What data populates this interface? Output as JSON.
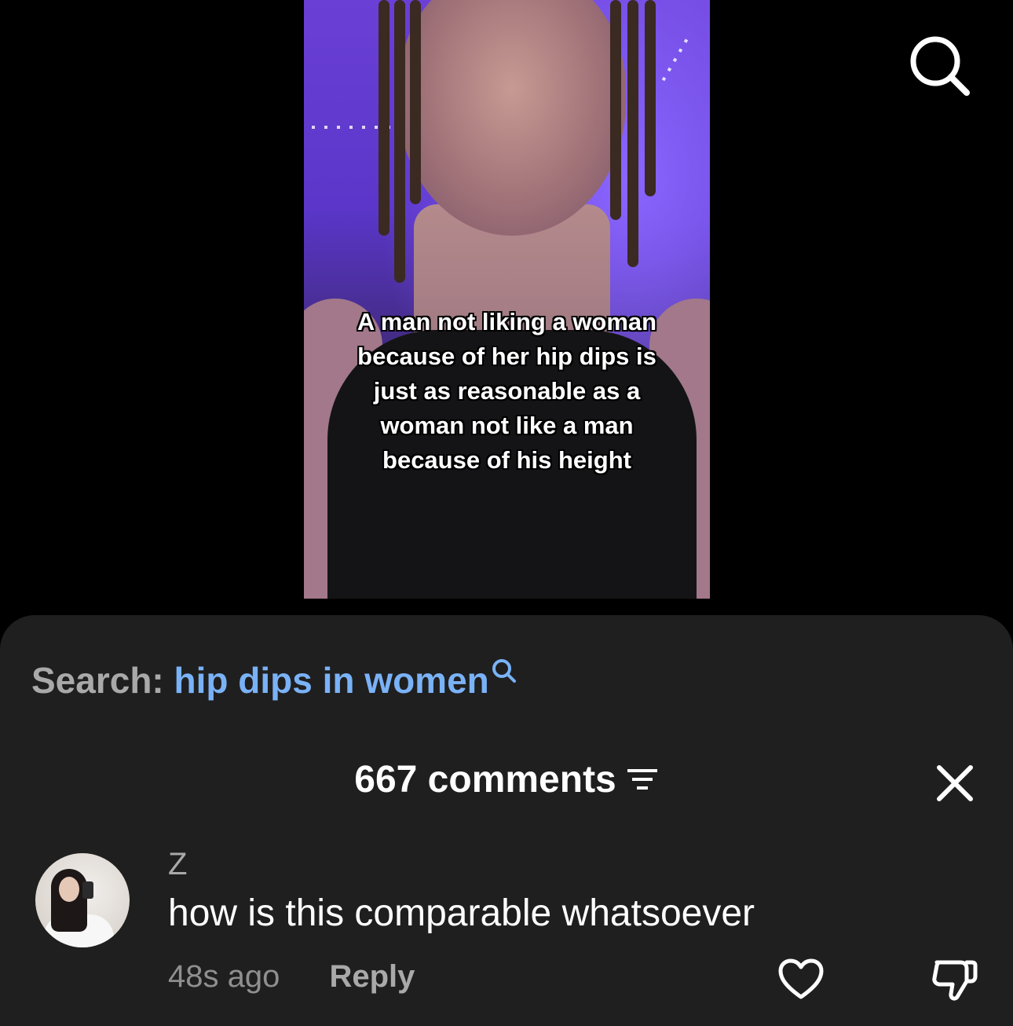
{
  "video": {
    "caption": "A man not liking a woman\nbecause of her hip dips is\njust as reasonable as a\nwoman not like a man\nbecause of his height"
  },
  "header": {
    "search_icon": "search-icon"
  },
  "comments_sheet": {
    "search_prefix": "Search:",
    "search_query": "hip dips in women",
    "search_query_icon": "search-icon",
    "comment_count": "667 comments",
    "filter_icon": "filter-icon",
    "close_icon": "close-icon",
    "comment": {
      "username": "Z",
      "text": "how is this comparable whatsoever",
      "timestamp": "48s ago",
      "reply_label": "Reply",
      "like_icon": "heart-outline-icon",
      "dislike_icon": "thumbs-down-icon"
    }
  },
  "colors": {
    "sheet_bg": "#1f1f1f",
    "link_blue": "#7ab2f7",
    "muted_text": "#a9a9a9"
  }
}
